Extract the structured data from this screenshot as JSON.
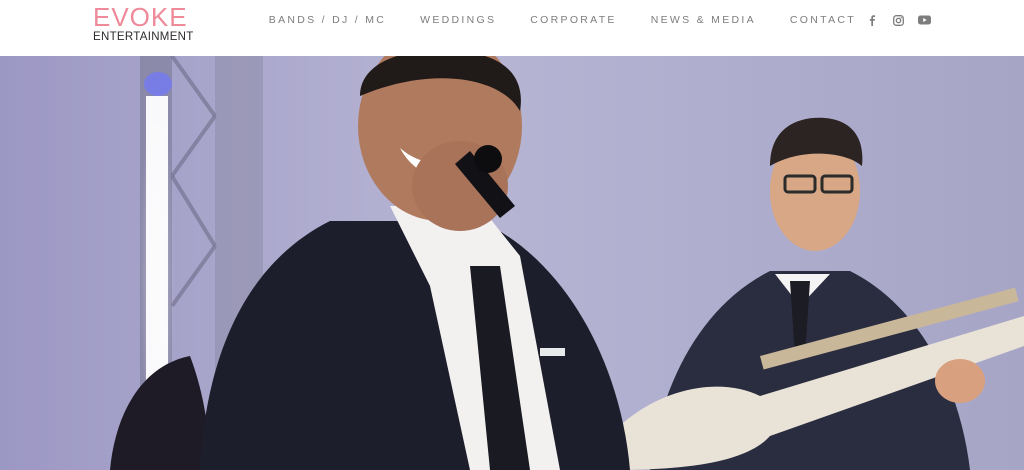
{
  "brand": {
    "name_top": "EVOKE",
    "name_bottom": "ENTERTAINMENT",
    "accent_color": "#ee8a99"
  },
  "nav": {
    "items": [
      {
        "label": "BANDS / DJ / MC"
      },
      {
        "label": "WEDDINGS"
      },
      {
        "label": "CORPORATE"
      },
      {
        "label": "NEWS & MEDIA"
      },
      {
        "label": "CONTACT"
      }
    ]
  },
  "social": {
    "icons": [
      "facebook-icon",
      "instagram-icon",
      "youtube-icon"
    ]
  },
  "hero": {
    "description_icon": "hero-photo"
  }
}
